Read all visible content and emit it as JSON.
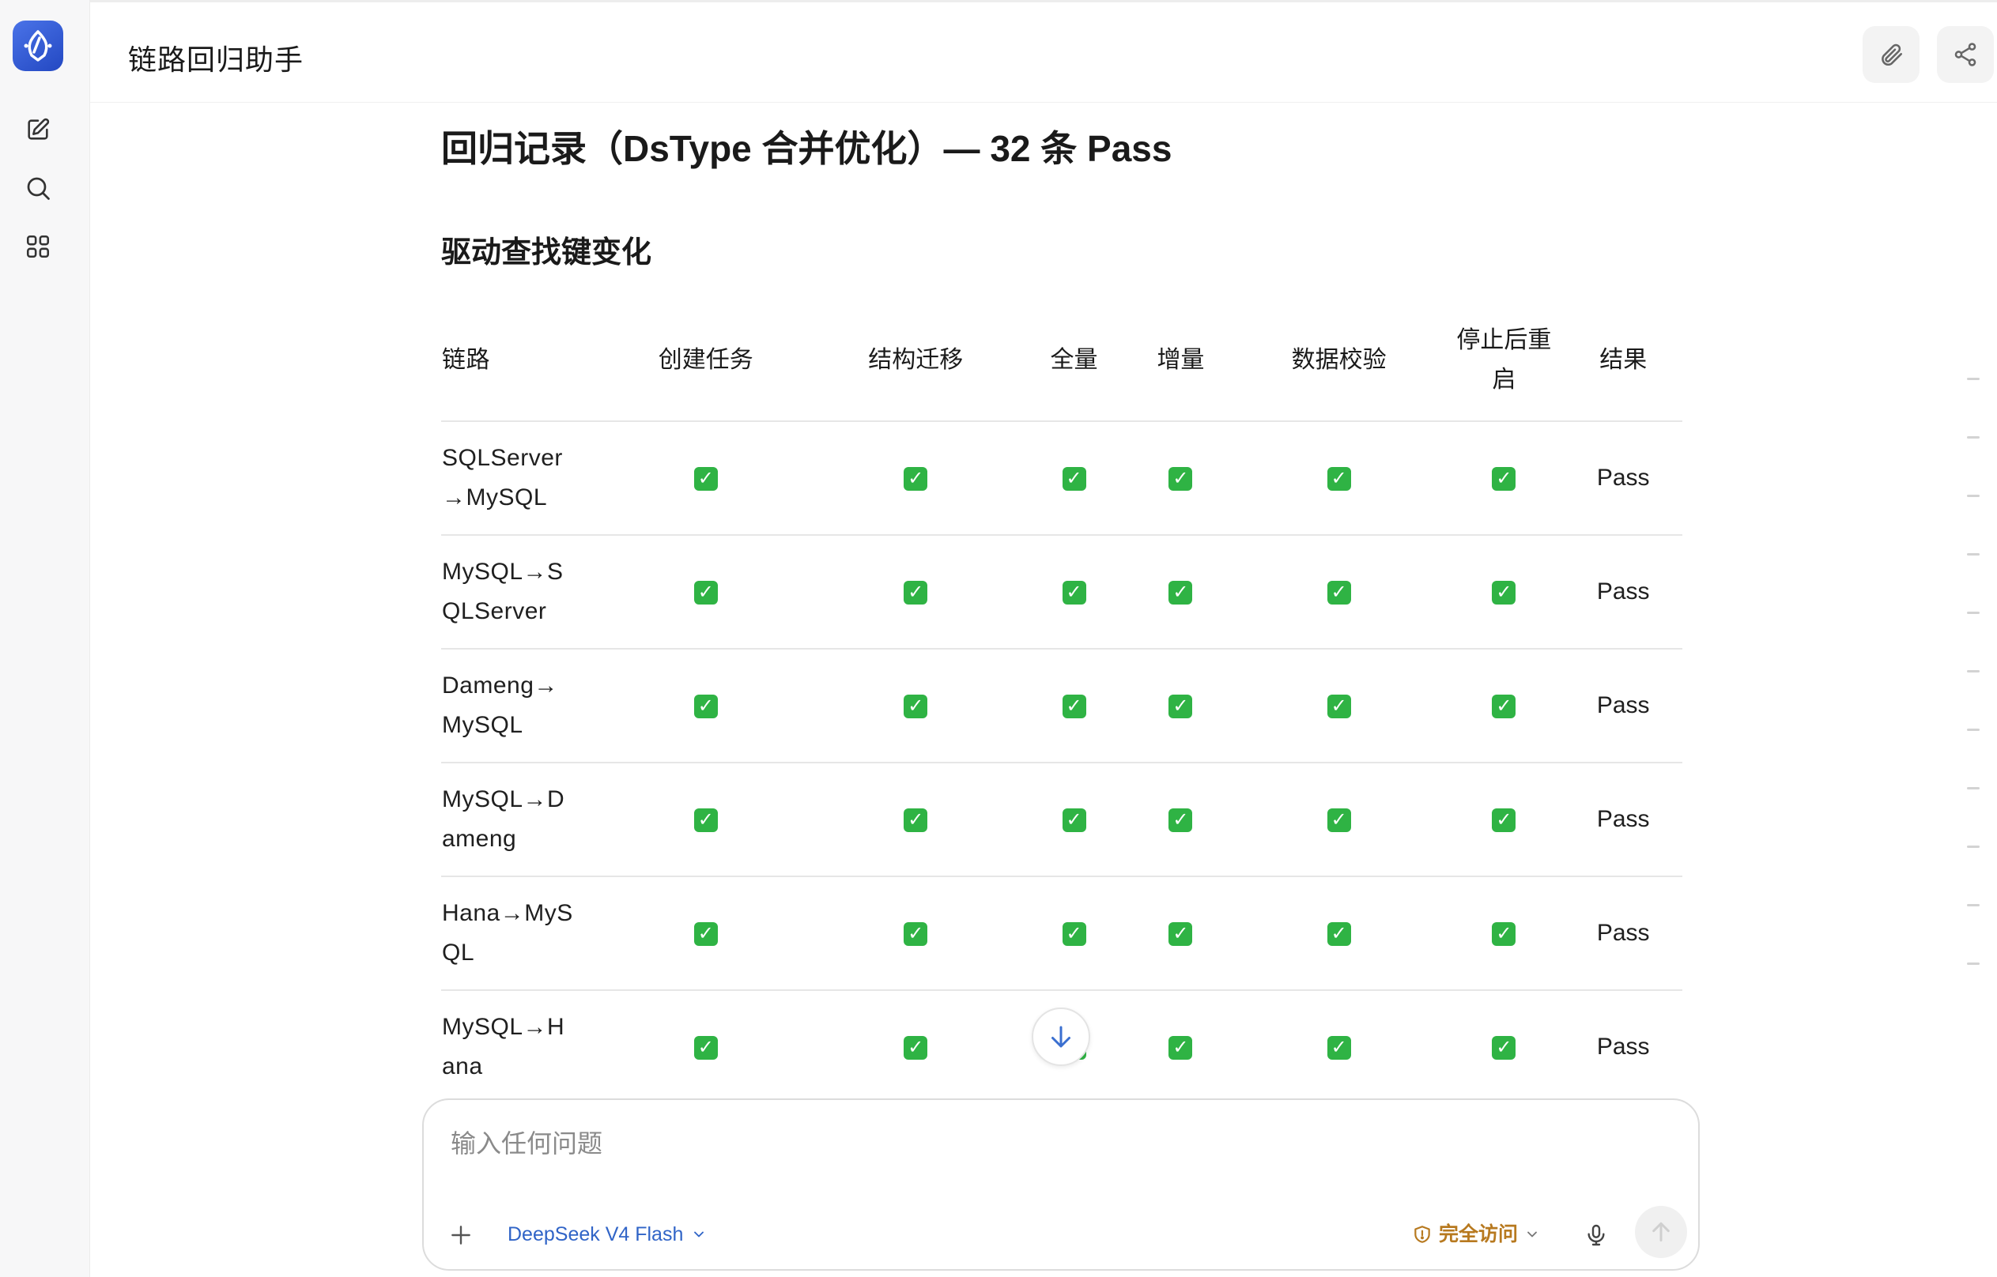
{
  "header": {
    "title": "链路回归助手"
  },
  "main": {
    "heading": "回归记录（DsType 合并优化）— 32 条 Pass",
    "subheading": "驱动查找键变化",
    "table": {
      "columns": [
        "链路",
        "创建任务",
        "结构迁移",
        "全量",
        "增量",
        "数据校验",
        "停止后重启",
        "结果"
      ],
      "rows": [
        {
          "route_line1": "SQLServer",
          "route_line2": "→MySQL",
          "result": "Pass"
        },
        {
          "route_line1": "MySQL→S",
          "route_line2": "QLServer",
          "result": "Pass"
        },
        {
          "route_line1": "Dameng→",
          "route_line2": "MySQL",
          "result": "Pass"
        },
        {
          "route_line1": "MySQL→D",
          "route_line2": "ameng",
          "result": "Pass"
        },
        {
          "route_line1": "Hana→MyS",
          "route_line2": "QL",
          "result": "Pass"
        },
        {
          "route_line1": "MySQL→H",
          "route_line2": "ana",
          "result": "Pass"
        }
      ],
      "check_glyph": "✓",
      "header_col6_line1": "停止后重",
      "header_col6_line2": "启"
    }
  },
  "composer": {
    "placeholder": "输入任何问题",
    "model_label": "DeepSeek V4 Flash",
    "access_label": "完全访问"
  },
  "colors": {
    "brand": "#2f5fd6",
    "check": "#2fb344",
    "model_link": "#3064c7",
    "access": "#b7791f"
  },
  "icons": [
    "app-logo-icon",
    "new-chat-icon",
    "search-icon",
    "apps-grid-icon",
    "paperclip-icon",
    "share-icon",
    "arrow-down-icon",
    "plus-icon",
    "chevron-down-icon",
    "shield-icon",
    "microphone-icon",
    "arrow-up-icon"
  ]
}
